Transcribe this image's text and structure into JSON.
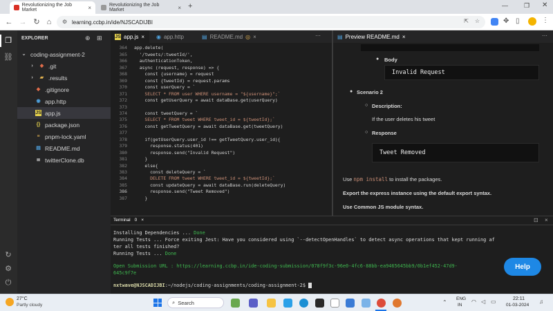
{
  "browser": {
    "tabs": [
      {
        "title": "Revolutionizing the Job Market"
      },
      {
        "title": "Revolutionizing the Job Market"
      }
    ],
    "new_tab": "+",
    "url": "learning.ccbp.in/ide/NJSCADIJBI"
  },
  "explorer": {
    "header": "EXPLORER",
    "items": [
      {
        "label": "coding-assignment-2",
        "icon": "chevron-down-icon"
      },
      {
        "label": ".git",
        "icon": "folder-icon"
      },
      {
        "label": ".results",
        "icon": "folder-icon"
      },
      {
        "label": ".gitignore",
        "icon": "git-icon"
      },
      {
        "label": "app.http",
        "icon": "http-icon"
      },
      {
        "label": "app.js",
        "icon": "js-icon"
      },
      {
        "label": "package.json",
        "icon": "json-icon"
      },
      {
        "label": "pnpm-lock.yaml",
        "icon": "yaml-icon"
      },
      {
        "label": "README.md",
        "icon": "markdown-icon"
      },
      {
        "label": "twitterClone.db",
        "icon": "db-icon"
      }
    ]
  },
  "editor": {
    "tabs": [
      {
        "label": "app.js"
      },
      {
        "label": "app.http"
      },
      {
        "label": "README.md"
      }
    ],
    "first_line": 363,
    "lines": [
      "",
      "app.delete(",
      "  '/tweets/:tweetId/',",
      "  authenticationToken,",
      "  async (request, response) => {",
      "    const {username} = request",
      "    const {tweetId} = request.params",
      "    const userQuery = `",
      "    SELECT * FROM user WHERE username = \"${username}\";`",
      "    const getUserQuery = await dataBase.get(userQuery)",
      "",
      "    const tweetQuery = `",
      "    SELECT * FROM tweet WHERE tweet_id = ${tweetId};`",
      "    const getTweetQuery = await dataBase.get(tweetQuery)",
      "",
      "    if(getUserQuery.user_id !== getTweetQuery.user_id){",
      "      response.status(401)",
      "      response.send(\"Invalid Request\")",
      "    }",
      "    else{",
      "      const deleteQuery = `",
      "      DELETE FROM tweet WHERE tweet_id = ${tweetId};`",
      "      const updateQuery = await dataBase.run(deleteQuery)",
      "      response.send(\"Tweet Removed\")",
      "    }"
    ]
  },
  "preview": {
    "title": "Preview README.md",
    "body_label": "Body",
    "invalid_request": "Invalid Request",
    "scenario": "Scenario 2",
    "description_label": "Description:",
    "description": "If the user deletes his tweet",
    "response_label": "Response",
    "tweet_removed": "Tweet Removed",
    "use_text_a": "Use ",
    "use_code": "npm install",
    "use_text_b": " to install the packages.",
    "export_text": "Export the express instance using the default export syntax.",
    "module_text": "Use Common JS module syntax."
  },
  "terminal": {
    "tab_label": "Terminal",
    "tab_count": "0",
    "lines": [
      {
        "text": "Installing Dependencies ... ",
        "suffix": "Done"
      },
      {
        "text": "Running Tests ... Force exiting Jest: Have you considered using `--detectOpenHandles` to detect async operations that kept running af",
        "suffix": ""
      },
      {
        "text": "ter all tests finished?",
        "suffix": ""
      },
      {
        "text": "Running Tests ... ",
        "suffix": "Done"
      }
    ],
    "submission_line1": "Open Submission URL : https://learning.ccbp.in/ide-coding-submission/078f9f3c-96e0-4fc6-88bb-ea9465645bb9/0b1ef452-47d9-",
    "submission_line2": "645c9f7e",
    "prompt_user": "nxtwave@NJSCADIJBI",
    "prompt_path": ":~/nodejs/coding-assignments/coding-assignment-2$ ",
    "help": "Help"
  },
  "taskbar": {
    "temperature": "27°C",
    "weather": "Partly cloudy",
    "search": "Search",
    "lang": "ENG",
    "region": "IN",
    "time": "22:11",
    "date": "01-03-2024"
  },
  "colors": {
    "accent": "#1e88e5",
    "done": "#3fb950",
    "link": "#3fb950",
    "prompt_user": "#dcdcaa"
  }
}
